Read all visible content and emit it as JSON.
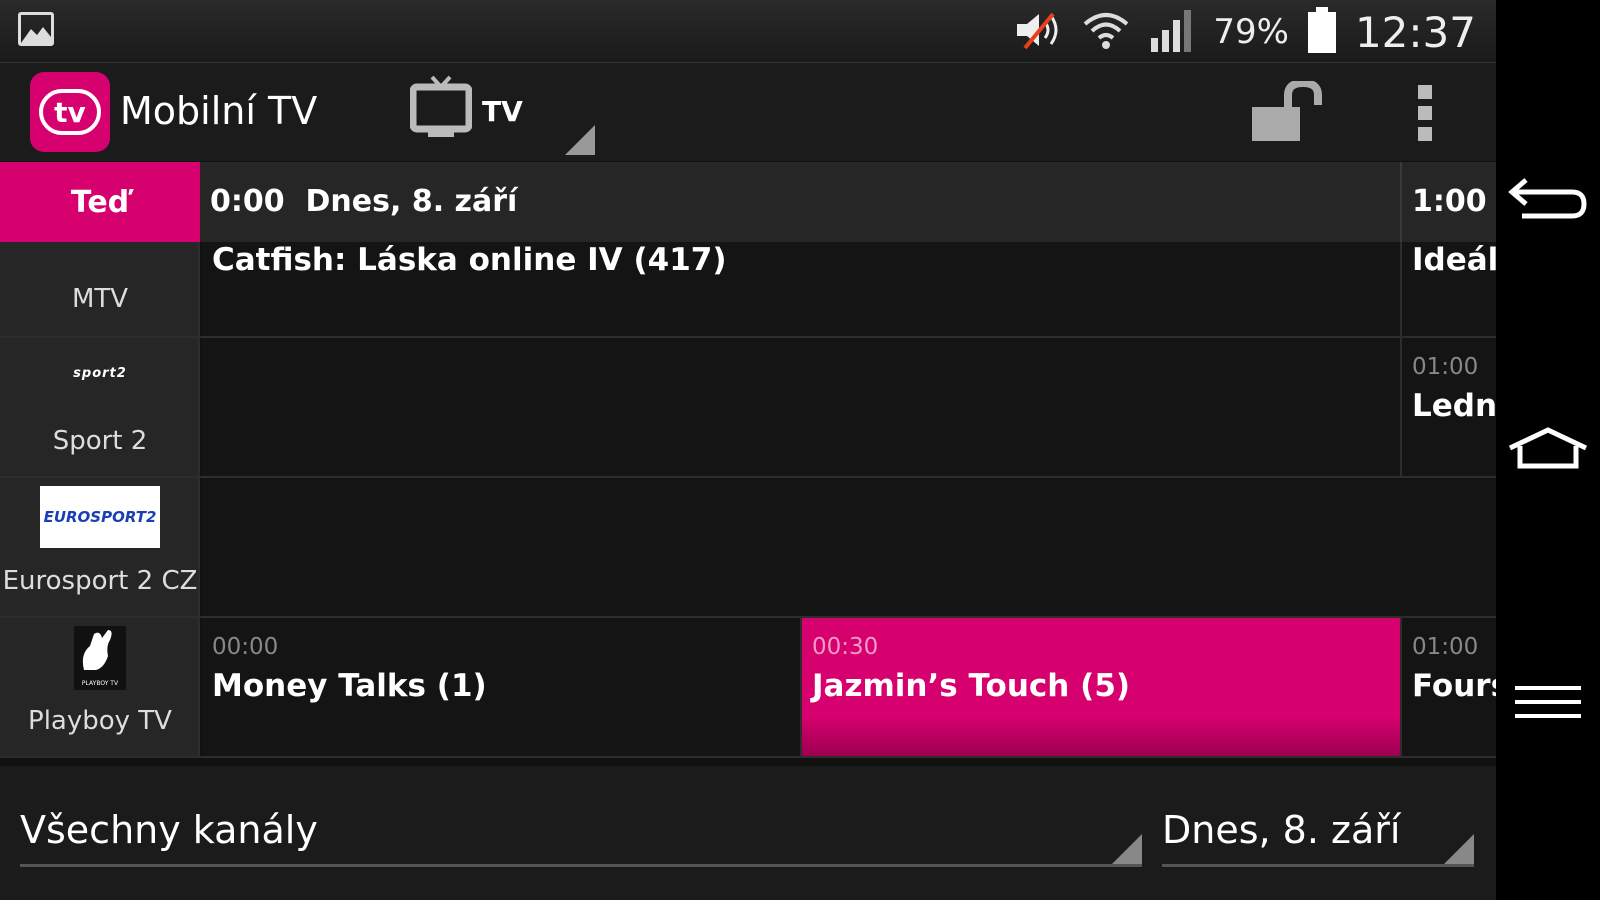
{
  "status": {
    "battery_percent": "79%",
    "time": "12:37"
  },
  "appbar": {
    "logo_text": "tv",
    "title": "Mobilní TV",
    "source_label": "TV"
  },
  "timeline": {
    "now_label": "Teď",
    "start_time": "0:00",
    "date": "Dnes, 8. září",
    "next_time": "1:00"
  },
  "channels": [
    {
      "name": "MTV",
      "logo_text": "",
      "programs": [
        {
          "time": "",
          "title": "Catfish: Láska online IV (417)"
        },
        {
          "time": "",
          "title": "Ideáln"
        }
      ]
    },
    {
      "name": "Sport 2",
      "logo_text": "sport2",
      "programs": [
        {
          "time": "",
          "title": ""
        },
        {
          "time": "01:00",
          "title": "Lední"
        }
      ]
    },
    {
      "name": "Eurosport 2 CZ",
      "logo_text": "EUROSPORT2",
      "programs": [
        {
          "time": "",
          "title": ""
        }
      ]
    },
    {
      "name": "Playboy TV",
      "logo_text": "PLAYBOY TV",
      "programs": [
        {
          "time": "00:00",
          "title": "Money Talks (1)"
        },
        {
          "time": "00:30",
          "title": "Jazmin’s Touch (5)"
        },
        {
          "time": "01:00",
          "title": "Fours"
        }
      ]
    }
  ],
  "filters": {
    "channel_filter": "Všechny kanály",
    "date_filter": "Dnes, 8. září"
  },
  "colors": {
    "accent": "#d6006e",
    "background": "#141414"
  },
  "icons": [
    "image-icon",
    "mute-icon",
    "wifi-icon",
    "signal-icon",
    "battery-icon",
    "tv-icon",
    "unlock-icon",
    "overflow-menu-icon",
    "back-icon",
    "home-icon",
    "recent-menu-icon"
  ]
}
